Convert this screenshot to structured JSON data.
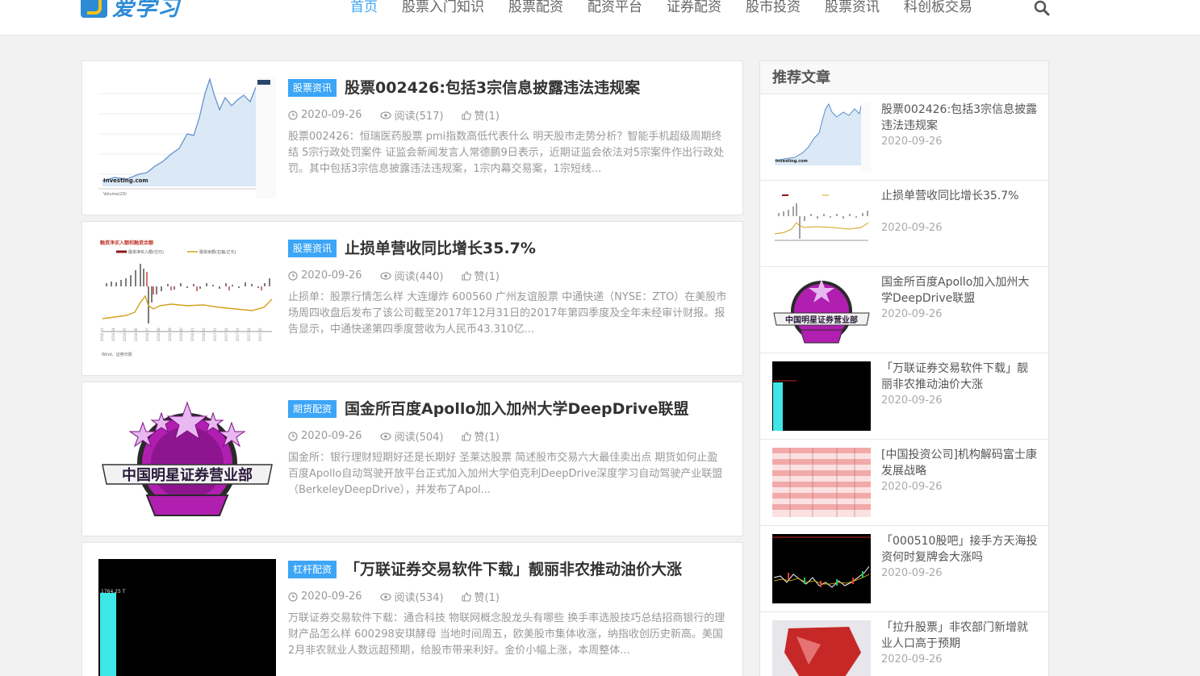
{
  "header": {
    "logo_text": "爱学习",
    "nav": [
      "首页",
      "股票入门知识",
      "股票配资",
      "配资平台",
      "证券配资",
      "股市投资",
      "股票资讯",
      "科创板交易"
    ]
  },
  "articles": [
    {
      "category": "股票资讯",
      "title": "股票002426:包括3宗信息披露违法违规案",
      "date": "2020-09-26",
      "views": "阅读(517)",
      "likes": "赞(1)",
      "excerpt": "股票002426：恒瑞医药股票 pmi指数高低代表什么 明天股市走势分析？智能手机超级周期终结 5宗行政处罚案件 证监会新闻发言人常德鹏9日表示，近期证监会依法对5宗案件作出行政处罚。其中包括3宗信息披露违法违规案，1宗内幕交易案，1宗短线..."
    },
    {
      "category": "股票资讯",
      "title": "止损单营收同比增长35.7%",
      "date": "2020-09-26",
      "views": "阅读(440)",
      "likes": "赞(1)",
      "excerpt": "止损单：股票行情怎么样 大连爆炸 600560 广州友谊股票 中通快递（NYSE：ZTO）在美股市场周四收盘后发布了该公司截至2017年12月31日的2017年第四季度及全年未经审计财报。报告显示，中通快递第四季度营收为人民币43.310亿..."
    },
    {
      "category": "期货配资",
      "title": "国金所百度Apollo加入加州大学DeepDrive联盟",
      "date": "2020-09-26",
      "views": "阅读(504)",
      "likes": "赞(1)",
      "excerpt": "国金所：银行理财短期好还是长期好 圣莱达股票 简述股市交易六大最佳卖出点 期货如何止盈 百度Apollo自动驾驶开放平台正式加入加州大学伯克利DeepDrive深度学习自动驾驶产业联盟（BerkeleyDeepDrive），并发布了Apol..."
    },
    {
      "category": "杠杆配资",
      "title": "「万联证券交易软件下载」靓丽非农推动油价大涨",
      "date": "2020-09-26",
      "views": "阅读(534)",
      "likes": "赞(1)",
      "excerpt": "万联证券交易软件下载：通合科技 物联网概念股龙头有哪些 换手率选股技巧总结招商银行的理财产品怎么样 600298安琪酵母 当地时间周五，欧美股市集体收涨，纳指收创历史新高。美国2月非农就业人数远超预期，给股市带来利好。金价小幅上涨，本周整体..."
    }
  ],
  "thumb_texts": {
    "investing": "Investing.com",
    "volume": "Volume(20)",
    "chart2_title": "融资净买入额和融资余额",
    "chart2_legend1": "融资净买入额(亿元)",
    "chart2_legend2": "融资余额(右轴,亿元)",
    "chart2_source": "Wind、证券日报",
    "badge_text": "中国明星证券营业部",
    "price_label": "1764.25 T"
  },
  "sidebar": {
    "title": "推荐文章",
    "items": [
      {
        "title": "股票002426:包括3宗信息披露违法违规案",
        "date": "2020-09-26"
      },
      {
        "title": "止损单营收同比增长35.7%",
        "date": "2020-09-26"
      },
      {
        "title": "国金所百度Apollo加入加州大学DeepDrive联盟",
        "date": "2020-09-26"
      },
      {
        "title": "「万联证券交易软件下载」靓丽非农推动油价大涨",
        "date": "2020-09-26"
      },
      {
        "title": "[中国投资公司]机构解码富士康发展战略",
        "date": "2020-09-26"
      },
      {
        "title": "「000510股吧」接手方天海投资何时复牌会大涨吗",
        "date": "2020-09-26"
      },
      {
        "title": "「拉升股票」非农部门新增就业人口高于预期",
        "date": "2020-09-26"
      }
    ]
  }
}
